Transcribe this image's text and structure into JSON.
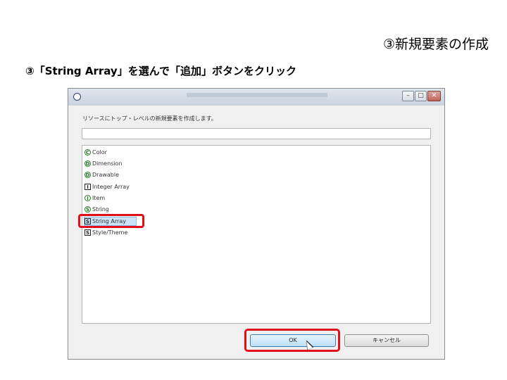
{
  "slide": {
    "title": "③新規要素の作成",
    "step_text": "③「String Array」を選んで「追加」ボタンをクリック"
  },
  "dialog": {
    "buttons": {
      "minimize": "–",
      "maximize": "□",
      "close": "✕"
    },
    "prompt": "リソースにトップ・レベルの新規要素を作成します。",
    "filter_value": "",
    "items": [
      {
        "badge": "C",
        "badge_shape": "circle",
        "label": "Color"
      },
      {
        "badge": "D",
        "badge_shape": "circle",
        "label": "Dimension"
      },
      {
        "badge": "D",
        "badge_shape": "circle",
        "label": "Drawable"
      },
      {
        "badge": "I",
        "badge_shape": "square",
        "label": "Integer Array"
      },
      {
        "badge": "I",
        "badge_shape": "circle",
        "label": "Item"
      },
      {
        "badge": "S",
        "badge_shape": "circle",
        "label": "String"
      },
      {
        "badge": "S",
        "badge_shape": "square",
        "label": "String Array",
        "selected": true
      },
      {
        "badge": "S",
        "badge_shape": "square",
        "label": "Style/Theme"
      }
    ],
    "ok_label": "OK",
    "cancel_label": "キャンセル"
  },
  "colors": {
    "highlight": "#e0101a",
    "selection": "#cde3f8"
  }
}
